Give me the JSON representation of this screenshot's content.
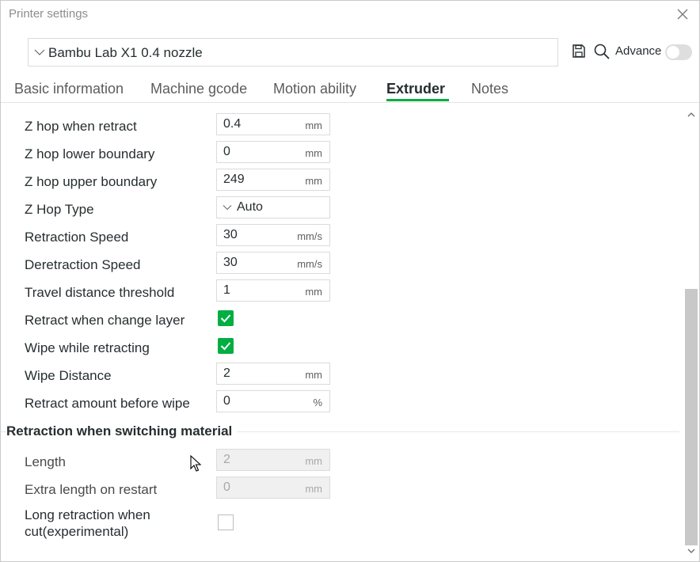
{
  "window": {
    "title": "Printer settings"
  },
  "preset": {
    "name": "Bambu Lab X1 0.4 nozzle"
  },
  "toolbar": {
    "advance_label": "Advance",
    "advance_on": false
  },
  "tabs": [
    {
      "label": "Basic information",
      "active": false
    },
    {
      "label": "Machine gcode",
      "active": false
    },
    {
      "label": "Motion ability",
      "active": false
    },
    {
      "label": "Extruder",
      "active": true
    },
    {
      "label": "Notes",
      "active": false
    }
  ],
  "rows": [
    {
      "label": "Z hop when retract",
      "value": "0.4",
      "unit": "mm"
    },
    {
      "label": "Z hop lower boundary",
      "value": "0",
      "unit": "mm"
    },
    {
      "label": "Z hop upper boundary",
      "value": "249",
      "unit": "mm"
    },
    {
      "label": "Z Hop Type",
      "value": "Auto"
    },
    {
      "label": "Retraction Speed",
      "value": "30",
      "unit": "mm/s"
    },
    {
      "label": "Deretraction Speed",
      "value": "30",
      "unit": "mm/s"
    },
    {
      "label": "Travel distance threshold",
      "value": "1",
      "unit": "mm"
    },
    {
      "label": "Retract when change layer",
      "checked": true
    },
    {
      "label": "Wipe while retracting",
      "checked": true
    },
    {
      "label": "Wipe Distance",
      "value": "2",
      "unit": "mm"
    },
    {
      "label": "Retract amount before wipe",
      "value": "0",
      "unit": "%"
    }
  ],
  "section": {
    "title": "Retraction when switching material",
    "rows": [
      {
        "label": "Length",
        "value": "2",
        "unit": "mm",
        "disabled": true
      },
      {
        "label": "Extra length on restart",
        "value": "0",
        "unit": "mm",
        "disabled": true
      },
      {
        "label_line1": "Long retraction when",
        "label_line2": "cut(experimental)",
        "checked": false
      }
    ]
  },
  "colors": {
    "accent": "#00ae42",
    "text": "#262e30",
    "border": "#dbdbdb"
  },
  "icons": [
    "close-icon",
    "chevron-down-icon",
    "save-icon",
    "search-icon",
    "check-icon",
    "arrow-up-icon",
    "arrow-down-icon",
    "mouse-pointer-icon"
  ]
}
